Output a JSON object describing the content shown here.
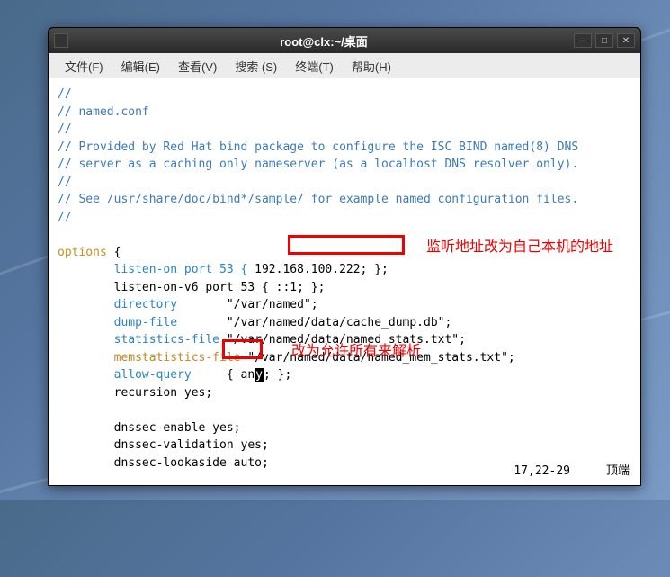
{
  "titlebar": {
    "title": "root@clx:~/桌面"
  },
  "menubar": {
    "file": "文件(F)",
    "edit": "编辑(E)",
    "view": "查看(V)",
    "search": "搜索 (S)",
    "terminal": "终端(T)",
    "help": "帮助(H)"
  },
  "content": {
    "line1": "//",
    "line2": "// named.conf",
    "line3": "//",
    "line4": "// Provided by Red Hat bind package to configure the ISC BIND named(8) DNS",
    "line5": "// server as a caching only nameserver (as a localhost DNS resolver only).",
    "line6": "//",
    "line7": "// See /usr/share/doc/bind*/sample/ for example named configuration files.",
    "line8": "//",
    "options_kw": "options",
    "brace": " {",
    "listen_on": "        listen-on port 53 { ",
    "listen_on_ip": "192.168.100.222;",
    "listen_on_end": " };",
    "listen_v6": "        listen-on-v6 port 53 { ::1; };",
    "directory_k": "        directory",
    "directory_v": "       \"/var/named\";",
    "dumpfile_k": "        dump-file",
    "dumpfile_v": "       \"/var/named/data/cache_dump.db\";",
    "stats_k": "        statistics-file",
    "stats_v": " \"/var/named/data/named_stats.txt\";",
    "memstats_k": "        memstatistics-file",
    "memstats_v": " \"/var/named/data/named_mem_stats.txt\";",
    "allow_k": "        allow-query",
    "allow_sp": "     { ",
    "allow_v1": "an",
    "allow_cursor": "y",
    "allow_v2": ";",
    "allow_end": " };",
    "recursion": "        recursion yes;",
    "dnssec1": "        dnssec-enable yes;",
    "dnssec2": "        dnssec-validation yes;",
    "dnssec3": "        dnssec-lookaside auto;"
  },
  "annotations": {
    "text1": "监听地址改为自己本机的地址",
    "text2": "改为允许所有来解析"
  },
  "statusbar": {
    "pos": "17,22-29",
    "mode": "顶端"
  }
}
